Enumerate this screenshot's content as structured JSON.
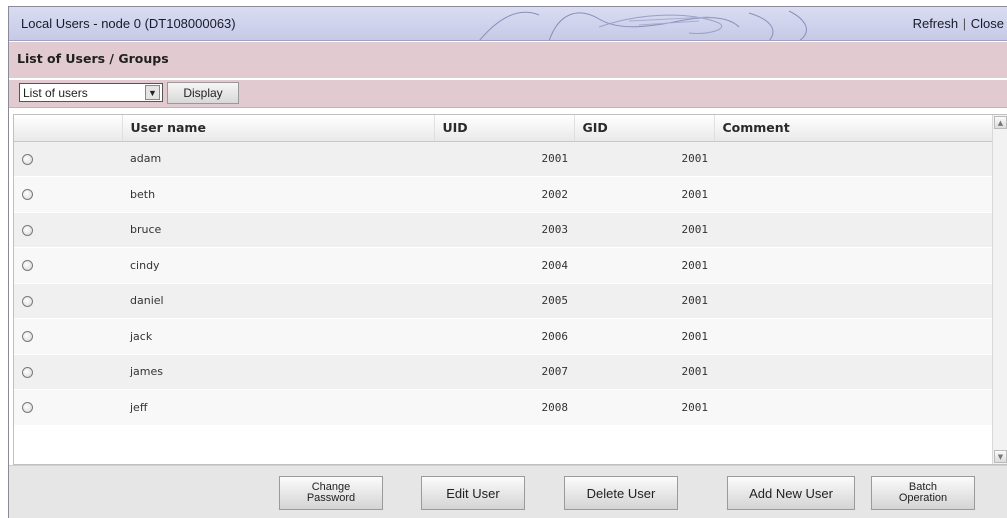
{
  "window": {
    "title": "Local Users - node 0 (DT108000063)",
    "refresh_label": "Refresh",
    "separator": "|",
    "close_label": "Close"
  },
  "section": {
    "title": "List of Users / Groups"
  },
  "toolbar": {
    "list_select_value": "List of users",
    "display_label": "Display"
  },
  "table": {
    "columns": [
      "User name",
      "UID",
      "GID",
      "Comment"
    ],
    "rows": [
      {
        "user": "adam",
        "uid": "2001",
        "gid": "2001",
        "comment": ""
      },
      {
        "user": "beth",
        "uid": "2002",
        "gid": "2001",
        "comment": ""
      },
      {
        "user": "bruce",
        "uid": "2003",
        "gid": "2001",
        "comment": ""
      },
      {
        "user": "cindy",
        "uid": "2004",
        "gid": "2001",
        "comment": ""
      },
      {
        "user": "daniel",
        "uid": "2005",
        "gid": "2001",
        "comment": ""
      },
      {
        "user": "jack",
        "uid": "2006",
        "gid": "2001",
        "comment": ""
      },
      {
        "user": "james",
        "uid": "2007",
        "gid": "2001",
        "comment": ""
      },
      {
        "user": "jeff",
        "uid": "2008",
        "gid": "2001",
        "comment": ""
      }
    ]
  },
  "actions": {
    "change_password": "Change\nPassword",
    "edit_user": "Edit User",
    "delete_user": "Delete User",
    "add_new_user": "Add New User",
    "batch_operation": "Batch\nOperation"
  },
  "colors": {
    "titlebar": "#c6cae6",
    "section": "#e2cbd0",
    "row_odd": "#f0f0f0",
    "row_even": "#f8f8f8"
  }
}
